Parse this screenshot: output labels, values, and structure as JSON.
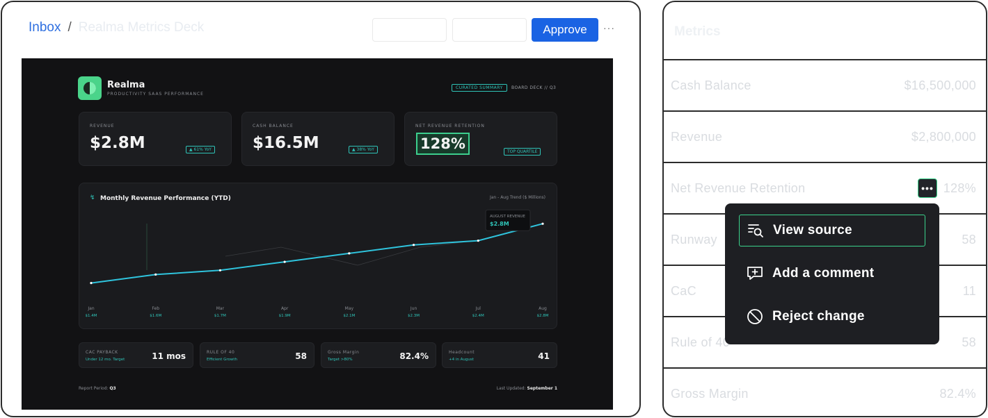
{
  "breadcrumb": {
    "root": "Inbox",
    "separator": "/",
    "current": "Realma Metrics Deck"
  },
  "header": {
    "approve_label": "Approve",
    "more_label": "···"
  },
  "deck": {
    "brand": "Realma",
    "subtitle": "PRODUCTIVITY SAAS PERFORMANCE",
    "curated_badge": "CURATED SUMMARY",
    "board_deck": "BOARD DECK // Q3",
    "kpis": [
      {
        "label": "REVENUE",
        "value": "$2.8M",
        "tag": "▲ 61% YoY"
      },
      {
        "label": "CASH BALANCE",
        "value": "$16.5M",
        "tag": "▲ 38% YoY"
      },
      {
        "label": "NET REVENUE RETENTION",
        "value": "128%",
        "tag": "TOP QUARTILE"
      }
    ],
    "chart": {
      "title": "Monthly Revenue Performance (YTD)",
      "trend_label": "Jan - Aug Trend ($ Millions)",
      "tooltip_label": "AUGUST REVENUE",
      "tooltip_value": "$2.8M",
      "value_labels": [
        "$1.4M",
        "$1.6M",
        "$1.7M",
        "$1.9M",
        "$2.1M",
        "$2.3M",
        "$2.4M",
        "$2.8M"
      ]
    },
    "minis": [
      {
        "title": "CAC PAYBACK",
        "sub": "Under 12 mo. Target",
        "value": "11 mos"
      },
      {
        "title": "RULE OF 40",
        "sub": "Efficient Growth",
        "value": "58"
      },
      {
        "title": "Gross Margin",
        "sub": "Target >80%",
        "value": "82.4%"
      },
      {
        "title": "Headcount",
        "sub": "+4 in August",
        "value": "41"
      }
    ],
    "footer": {
      "period_label": "Report Period:",
      "period_value": "Q3",
      "updated_label": "Last Updated:",
      "updated_value": "September 1"
    }
  },
  "chart_data": {
    "type": "line",
    "title": "Monthly Revenue Performance (YTD)",
    "categories": [
      "Jan",
      "Feb",
      "Mar",
      "Apr",
      "May",
      "Jun",
      "Jul",
      "Aug"
    ],
    "series": [
      {
        "values": [
          1.4,
          1.6,
          1.7,
          1.9,
          2.1,
          2.3,
          2.4,
          2.8
        ]
      }
    ],
    "ylim": [
      1.0,
      3.0
    ],
    "grid": false,
    "colors": {
      "line": "#2fc4dd"
    }
  },
  "table": {
    "title": "Metrics",
    "rows": [
      {
        "key": "Cash Balance",
        "value": "$16,500,000"
      },
      {
        "key": "Revenue",
        "value": "$2,800,000"
      },
      {
        "key": "Net Revenue Retention",
        "value": "128%"
      },
      {
        "key": "Runway",
        "value": "58"
      },
      {
        "key": "CaC",
        "value": "11"
      },
      {
        "key": "Rule of 40",
        "value": "58"
      },
      {
        "key": "Gross Margin",
        "value": "82.4%"
      }
    ],
    "row_action_label": "•••"
  },
  "context_menu": {
    "items": [
      {
        "label": "View source",
        "icon": "view-source-icon"
      },
      {
        "label": "Add a comment",
        "icon": "add-comment-icon"
      },
      {
        "label": "Reject change",
        "icon": "reject-icon"
      }
    ]
  }
}
